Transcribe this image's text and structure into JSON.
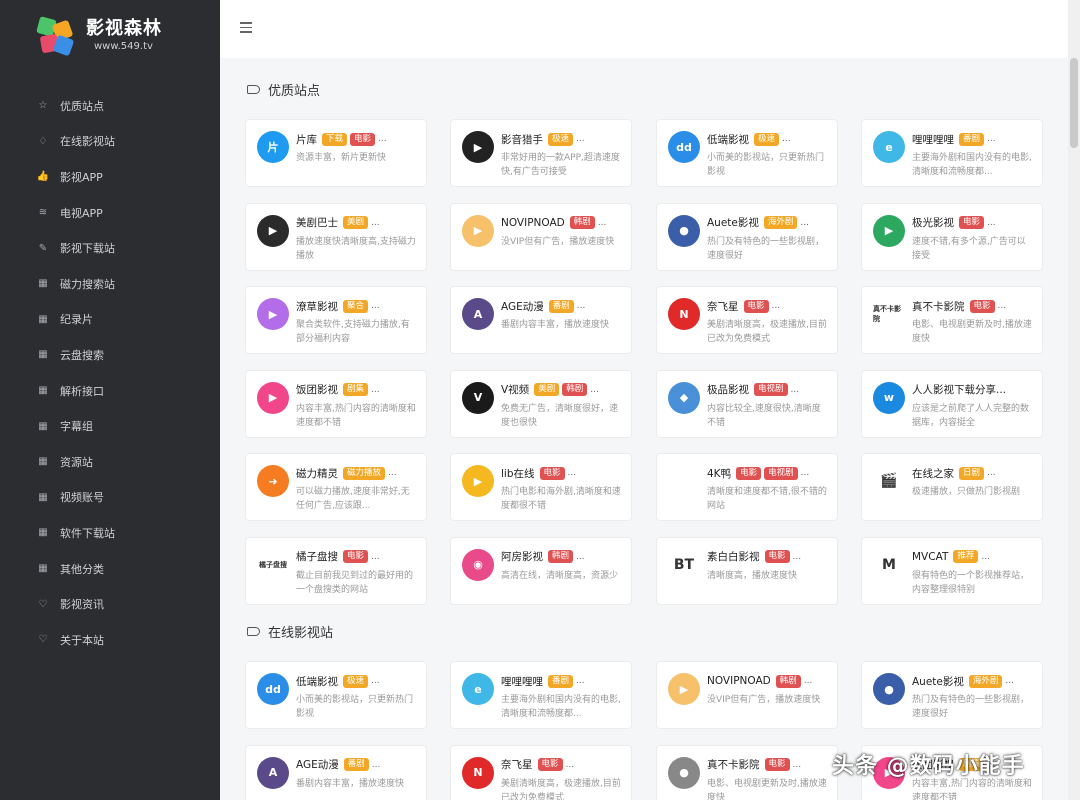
{
  "brand": {
    "title": "影视森林",
    "url": "www.549.tv"
  },
  "nav": [
    {
      "label": "优质站点",
      "icon": "star-icon",
      "glyph": "☆"
    },
    {
      "label": "在线影视站",
      "icon": "bulb-icon",
      "glyph": "♢"
    },
    {
      "label": "影视APP",
      "icon": "thumbs-up-icon",
      "glyph": "👍"
    },
    {
      "label": "电视APP",
      "icon": "wifi-icon",
      "glyph": "≋"
    },
    {
      "label": "影视下载站",
      "icon": "pencil-icon",
      "glyph": "✎"
    },
    {
      "label": "磁力搜索站",
      "icon": "grid-icon",
      "glyph": "▦"
    },
    {
      "label": "纪录片",
      "icon": "grid-icon",
      "glyph": "▦"
    },
    {
      "label": "云盘搜索",
      "icon": "grid-icon",
      "glyph": "▦"
    },
    {
      "label": "解析接口",
      "icon": "grid-icon",
      "glyph": "▦"
    },
    {
      "label": "字幕组",
      "icon": "grid-icon",
      "glyph": "▦"
    },
    {
      "label": "资源站",
      "icon": "grid-icon",
      "glyph": "▦"
    },
    {
      "label": "视频账号",
      "icon": "grid-icon",
      "glyph": "▦"
    },
    {
      "label": "软件下载站",
      "icon": "grid-icon",
      "glyph": "▦"
    },
    {
      "label": "其他分类",
      "icon": "grid-icon",
      "glyph": "▦"
    },
    {
      "label": "影视资讯",
      "icon": "heart-icon",
      "glyph": "♡"
    },
    {
      "label": "关于本站",
      "icon": "heart-icon",
      "glyph": "♡"
    }
  ],
  "sections": [
    {
      "title": "优质站点",
      "cards": [
        {
          "name": "片库",
          "badges": [
            "下载",
            "电影"
          ],
          "desc": "资源丰富，新片更新快",
          "icon_text": "片",
          "color": "#1e9bf0"
        },
        {
          "name": "影音猎手",
          "badges": [
            "极速"
          ],
          "desc": "非常好用的一款APP,超清速度快,有广告可接受",
          "icon_text": "▶",
          "color": "#222222"
        },
        {
          "name": "低端影视",
          "badges": [
            "极速"
          ],
          "desc": "小而美的影视站，只更新热门影视",
          "icon_text": "dd",
          "color": "#2a8ee8"
        },
        {
          "name": "哩哩哩哩",
          "badges": [
            "番剧"
          ],
          "desc": "主要海外剧和国内没有的电影,清晰度和流畅度都...",
          "icon_text": "e",
          "color": "#3fb8e8"
        },
        {
          "name": "美剧巴士",
          "badges": [
            "美剧"
          ],
          "desc": "播放速度快清晰度高,支持磁力播放",
          "icon_text": "▶",
          "color": "#2b2b2b"
        },
        {
          "name": "NOVIPNOAD",
          "badges": [
            "韩剧"
          ],
          "desc": "没VIP但有广告，播放速度快",
          "icon_text": "▶",
          "color": "#f6c16a"
        },
        {
          "name": "Auete影视",
          "badges": [
            "海外剧"
          ],
          "desc": "热门及有特色的一些影视剧，速度很好",
          "icon_text": "●",
          "color": "#3a5ea8"
        },
        {
          "name": "极光影视",
          "badges": [
            "电影"
          ],
          "desc": "速度不错,有多个源,广告可以接受",
          "icon_text": "▶",
          "color": "#2da860"
        },
        {
          "name": "潦草影视",
          "badges": [
            "聚合"
          ],
          "desc": "聚合类软件,支持磁力播放,有部分福利内容",
          "icon_text": "▶",
          "color": "#b46de8"
        },
        {
          "name": "AGE动漫",
          "badges": [
            "番剧"
          ],
          "desc": "番剧内容丰富，播放速度快",
          "icon_text": "A",
          "color": "#5b4a8a"
        },
        {
          "name": "奈飞星",
          "badges": [
            "电影"
          ],
          "desc": "美剧清晰度高，极速播放,目前已改为免费模式",
          "icon_text": "N",
          "color": "#e02a2a"
        },
        {
          "name": "真不卡影院",
          "badges": [
            "电影"
          ],
          "desc": "电影、电视剧更新及时,播放速度快",
          "icon_text": "真不卡影院",
          "color": "#ffffff"
        },
        {
          "name": "饭团影视",
          "badges": [
            "剧集"
          ],
          "desc": "内容丰富,热门内容的清晰度和速度都不错",
          "icon_text": "▶",
          "color": "#f2468a"
        },
        {
          "name": "V视频",
          "badges": [
            "美剧",
            "韩剧"
          ],
          "desc": "免费无广告，清晰度很好，速度也很快",
          "icon_text": "V",
          "color": "#1a1a1a"
        },
        {
          "name": "极品影视",
          "badges": [
            "电视剧"
          ],
          "desc": "内容比较全,速度很快,清晰度不错",
          "icon_text": "◆",
          "color": "#4a90d9"
        },
        {
          "name": "人人影视下载分享...",
          "badges": [],
          "desc": "应该是之前爬了人人完整的数据库，内容挺全",
          "icon_text": "w",
          "color": "#1a8ae0"
        },
        {
          "name": "磁力精灵",
          "badges": [
            "磁力播放"
          ],
          "desc": "可以磁力播放,速度非常好,无任何广告,应该跟...",
          "icon_text": "➜",
          "color": "#f57c20"
        },
        {
          "name": "lib在线",
          "badges": [
            "电影"
          ],
          "desc": "热门电影和海外剧,清晰度和速度都很不错",
          "icon_text": "▶",
          "color": "#f5b820"
        },
        {
          "name": "4K鸭",
          "badges": [
            "电影",
            "电视剧"
          ],
          "desc": "清晰度和速度都不错,很不错的网站",
          "icon_text": "",
          "color": "#ffffff"
        },
        {
          "name": "在线之家",
          "badges": [
            "日剧"
          ],
          "desc": "极速播放，只做热门影视剧",
          "icon_text": "🎬",
          "color": "#ffffff"
        },
        {
          "name": "橘子盘搜",
          "badges": [
            "电影"
          ],
          "desc": "截止目前我见到过的最好用的一个盘搜类的网站",
          "icon_text": "橘子盘搜",
          "color": "#ffffff"
        },
        {
          "name": "阿房影视",
          "badges": [
            "韩剧"
          ],
          "desc": "高清在线，清晰度高，资源少",
          "icon_text": "◉",
          "color": "#e84a8a"
        },
        {
          "name": "素白白影视",
          "badges": [
            "电影"
          ],
          "desc": "清晰度高，播放速度快",
          "icon_text": "BT",
          "color": "#ffffff"
        },
        {
          "name": "MVCAT",
          "badges": [
            "推荐"
          ],
          "desc": "很有特色的一个影视推荐站，内容整理很特别",
          "icon_text": "M",
          "color": "#ffffff"
        }
      ]
    },
    {
      "title": "在线影视站",
      "cards": [
        {
          "name": "低端影视",
          "badges": [
            "极速"
          ],
          "desc": "小而美的影视站，只更新热门影视",
          "icon_text": "dd",
          "color": "#2a8ee8"
        },
        {
          "name": "哩哩哩哩",
          "badges": [
            "番剧"
          ],
          "desc": "主要海外剧和国内没有的电影,清晰度和流畅度都...",
          "icon_text": "e",
          "color": "#3fb8e8"
        },
        {
          "name": "NOVIPNOAD",
          "badges": [
            "韩剧"
          ],
          "desc": "没VIP但有广告，播放速度快",
          "icon_text": "▶",
          "color": "#f6c16a"
        },
        {
          "name": "Auete影视",
          "badges": [
            "海外剧"
          ],
          "desc": "热门及有特色的一些影视剧，速度很好",
          "icon_text": "●",
          "color": "#3a5ea8"
        },
        {
          "name": "AGE动漫",
          "badges": [
            "番剧"
          ],
          "desc": "番剧内容丰富，播放速度快",
          "icon_text": "A",
          "color": "#5b4a8a"
        },
        {
          "name": "奈飞星",
          "badges": [
            "电影"
          ],
          "desc": "美剧清晰度高，极速播放,目前已改为免费模式",
          "icon_text": "N",
          "color": "#e02a2a"
        },
        {
          "name": "真不卡影院",
          "badges": [
            "电影"
          ],
          "desc": "电影、电视剧更新及时,播放速度快",
          "icon_text": "●",
          "color": "#888888"
        },
        {
          "name": "饭团影视",
          "badges": [
            "剧集"
          ],
          "desc": "内容丰富,热门内容的清晰度和速度都不错",
          "icon_text": "▶",
          "color": "#f2468a"
        }
      ]
    }
  ],
  "badge_colors": {
    "下载": "#f2a826",
    "电影": "#e05252",
    "极速": "#f2a826",
    "番剧": "#f2a826",
    "美剧": "#f2a826",
    "韩剧": "#e05252",
    "海外剧": "#f2a826",
    "聚合": "#f2a826",
    "剧集": "#f2a826",
    "电视剧": "#e05252",
    "磁力播放": "#f2a826",
    "日剧": "#f2a826",
    "推荐": "#f2a826"
  },
  "watermark": "头条 @数码小能手"
}
